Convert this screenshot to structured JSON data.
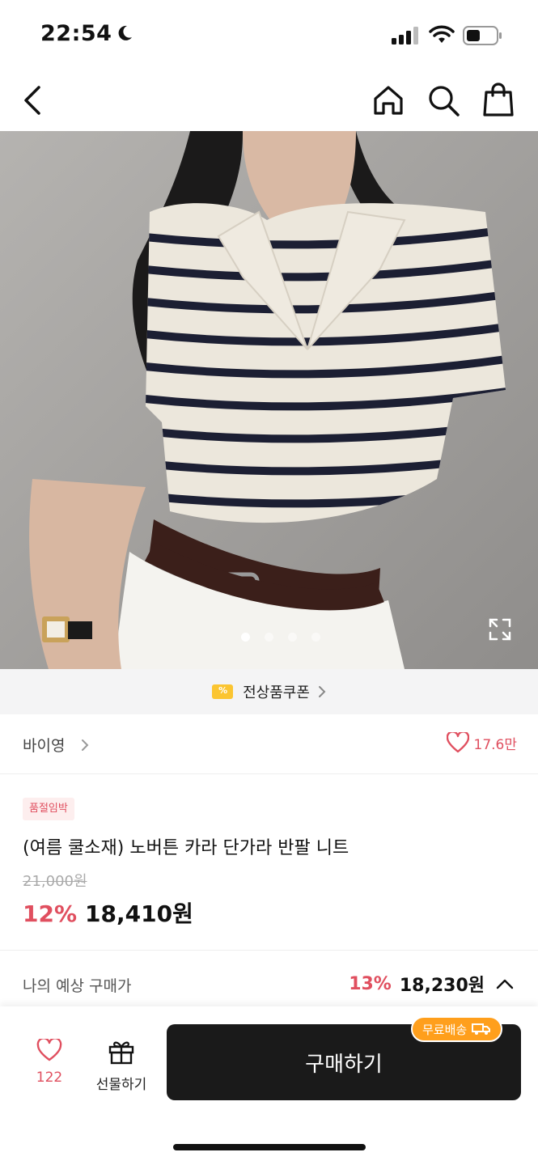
{
  "status_bar": {
    "time": "22:54"
  },
  "nav": {
    "icons": [
      "back-icon",
      "home-icon",
      "search-icon",
      "shopping-bag-icon"
    ]
  },
  "hero": {
    "image_count": 4,
    "active_index": 0
  },
  "coupon": {
    "label": "전상품쿠폰",
    "icon_glyph": "%"
  },
  "brand": {
    "name": "바이영",
    "likes": "17.6만"
  },
  "product": {
    "badge": "품절임박",
    "title": "(여름 쿨소재) 노버튼 카라 단가라 반팔 니트",
    "original_price": "21,000원",
    "discount": "12%",
    "price": "18,410원"
  },
  "expected": {
    "label": "나의 예상 구매가",
    "discount": "13%",
    "price": "18,230원"
  },
  "bottom_bar": {
    "wish_count": "122",
    "gift_label": "선물하기",
    "buy_label": "구매하기",
    "free_shipping": "무료배송"
  },
  "colors": {
    "accent": "#e04f5f",
    "button": "#1a1a1a",
    "shipping_badge": "#ff9f1c",
    "coupon": "#fbc531"
  }
}
